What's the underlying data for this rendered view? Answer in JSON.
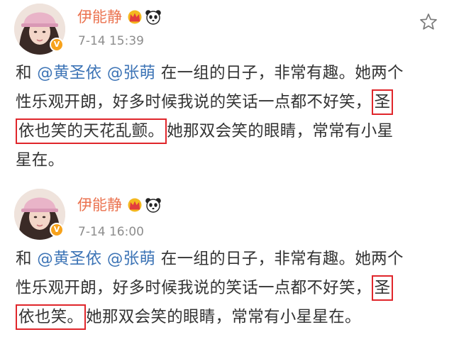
{
  "posts": [
    {
      "username": "伊能静",
      "timestamp": "7-14 15:39",
      "verified_badge": "V",
      "crown_icon": "crown-icon",
      "panda_icon": "panda-icon",
      "body": {
        "l1_pre": "和",
        "mention1": "@黄圣依",
        "mention2": "@张萌",
        "l1_post": "在一组的日子，非常有趣。她两个",
        "l2_pre": "性乐观开朗，好多时候我说的笑话一点都不好笑，",
        "l2_hl": "圣",
        "l3_hl": "依也笑的天花乱颤。",
        "l3_post": "她那双会笑的眼睛，常常有小星",
        "l4": "星在。"
      }
    },
    {
      "username": "伊能静",
      "timestamp": "7-14 16:00",
      "verified_badge": "V",
      "crown_icon": "crown-icon",
      "panda_icon": "panda-icon",
      "body": {
        "l1_pre": "和",
        "mention1": "@黄圣依",
        "mention2": "@张萌",
        "l1_post": "在一组的日子，非常有趣。她两个",
        "l2_pre": "性乐观开朗，好多时候我说的笑话一点都不好笑，",
        "l2_hl": "圣",
        "l3_hl": "依也笑。",
        "l3_post": "她那双会笑的眼睛，常常有小星星在。"
      }
    }
  ],
  "star_icon": "star-outline-icon",
  "colors": {
    "username": "#eb7350",
    "mention": "#3d74b6",
    "highlight_border": "#e0262b",
    "timestamp": "#8d8d8d",
    "badge": "#f7a21b"
  }
}
